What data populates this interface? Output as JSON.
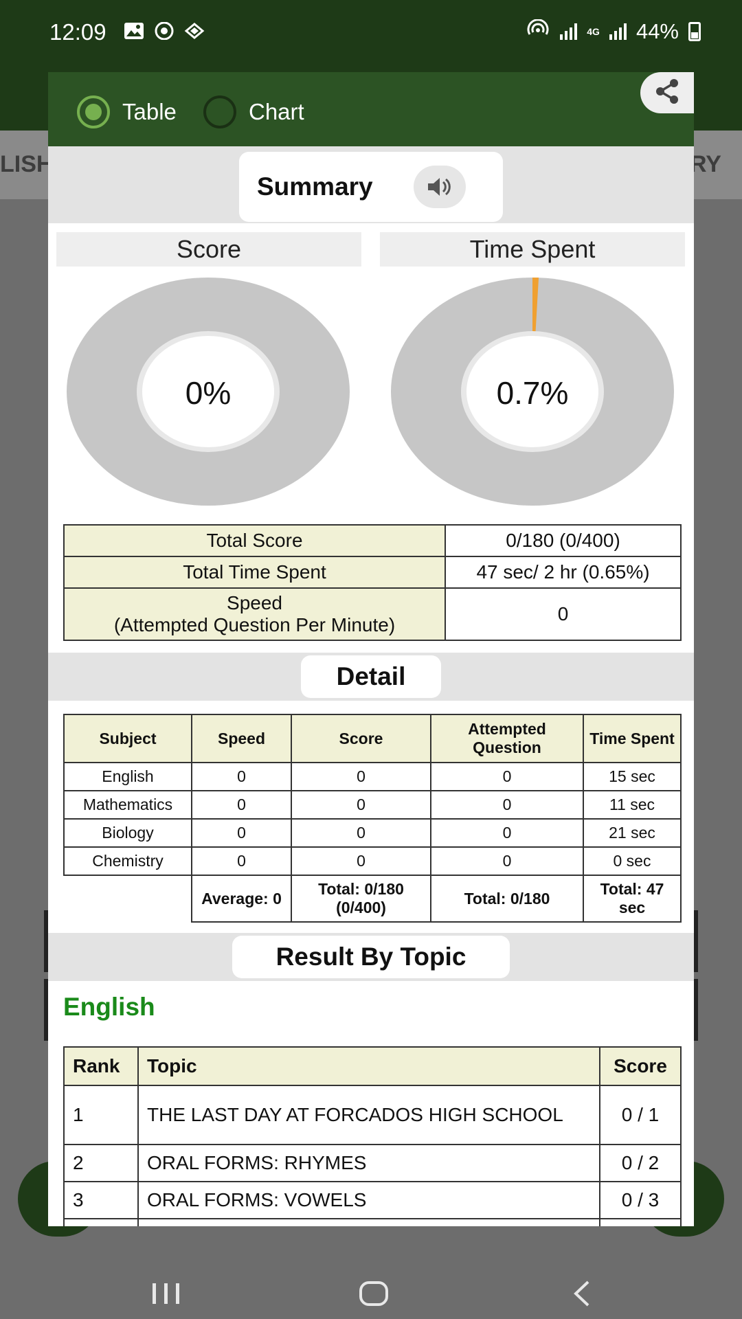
{
  "status_bar": {
    "time": "12:09",
    "battery": "44%",
    "network": "4G"
  },
  "background": {
    "tab_left": "LISH",
    "tab_right": "RY"
  },
  "dialog": {
    "view_options": [
      {
        "label": "Table",
        "selected": true
      },
      {
        "label": "Chart",
        "selected": false
      }
    ],
    "summary": {
      "title": "Summary",
      "score_label": "Score",
      "score_percent": "0%",
      "score_value": 0,
      "time_label": "Time Spent",
      "time_percent": "0.7%",
      "time_value": 0.7,
      "rows": [
        {
          "label": "Total Score",
          "value": "0/180 (0/400)"
        },
        {
          "label": "Total Time Spent",
          "value": "47 sec/ 2 hr (0.65%)"
        },
        {
          "label_line1": "Speed",
          "label_line2": "(Attempted Question Per Minute)",
          "value": "0"
        }
      ]
    },
    "detail": {
      "title": "Detail",
      "headers": [
        "Subject",
        "Speed",
        "Score",
        "Attempted Question",
        "Time Spent"
      ],
      "rows": [
        [
          "English",
          "0",
          "0",
          "0",
          "15 sec"
        ],
        [
          "Mathematics",
          "0",
          "0",
          "0",
          "11 sec"
        ],
        [
          "Biology",
          "0",
          "0",
          "0",
          "21 sec"
        ],
        [
          "Chemistry",
          "0",
          "0",
          "0",
          "0 sec"
        ]
      ],
      "totals": [
        "Average: 0",
        "Total: 0/180 (0/400)",
        "Total: 0/180",
        "Total: 47 sec"
      ]
    },
    "result_by_topic": {
      "title": "Result By Topic",
      "subject": "English",
      "headers": [
        "Rank",
        "Topic",
        "Score"
      ],
      "rows": [
        [
          "1",
          "THE LAST DAY AT FORCADOS HIGH SCHOOL",
          "0 / 1"
        ],
        [
          "2",
          "ORAL FORMS: RHYMES",
          "0 / 2"
        ],
        [
          "3",
          "ORAL FORMS: VOWELS",
          "0 / 3"
        ]
      ]
    }
  },
  "colors": {
    "header_green": "#2c5324",
    "status_green": "#1e3a17",
    "radio_green": "#76b04f",
    "topic_green": "#1a8a1a",
    "table_header": "#f1f1d6",
    "donut_gray": "#c6c6c6",
    "time_accent": "#f0a030"
  }
}
